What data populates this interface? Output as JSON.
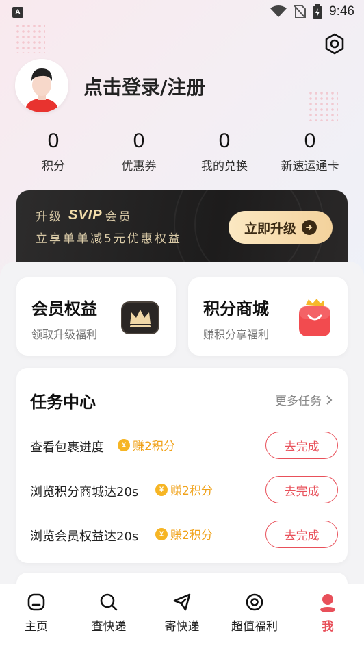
{
  "status_bar": {
    "app_badge": "A",
    "time": "9:46"
  },
  "header": {
    "login_text": "点击登录/注册"
  },
  "stats": [
    {
      "value": "0",
      "label": "积分"
    },
    {
      "value": "0",
      "label": "优惠券"
    },
    {
      "value": "0",
      "label": "我的兑换"
    },
    {
      "value": "0",
      "label": "新速运通卡"
    }
  ],
  "vip_banner": {
    "prefix": "升级",
    "svip": "SVIP",
    "suffix": "会员",
    "subtitle": "立享单单减5元优惠权益",
    "button_label": "立即升级"
  },
  "feature_cards": {
    "member": {
      "title": "会员权益",
      "subtitle": "领取升级福利"
    },
    "mall": {
      "title": "积分商城",
      "subtitle": "赚积分享福利"
    }
  },
  "tasks": {
    "title": "任务中心",
    "more_label": "更多任务",
    "coin_glyph": "¥",
    "items": [
      {
        "name": "查看包裹进度",
        "reward": "赚2积分",
        "button": "去完成"
      },
      {
        "name": "浏览积分商城达20s",
        "reward": "赚2积分",
        "button": "去完成"
      },
      {
        "name": "浏览会员权益达20s",
        "reward": "赚2积分",
        "button": "去完成"
      }
    ]
  },
  "tabbar": {
    "items": [
      {
        "label": "主页",
        "icon": "home-icon"
      },
      {
        "label": "查快递",
        "icon": "search-icon"
      },
      {
        "label": "寄快递",
        "icon": "send-icon"
      },
      {
        "label": "超值福利",
        "icon": "benefits-icon"
      },
      {
        "label": "我",
        "icon": "profile-icon",
        "active": true
      }
    ]
  },
  "colors": {
    "accent": "#e8505a",
    "reward": "#f0a21a",
    "vip_gold": "#f3d29c"
  }
}
